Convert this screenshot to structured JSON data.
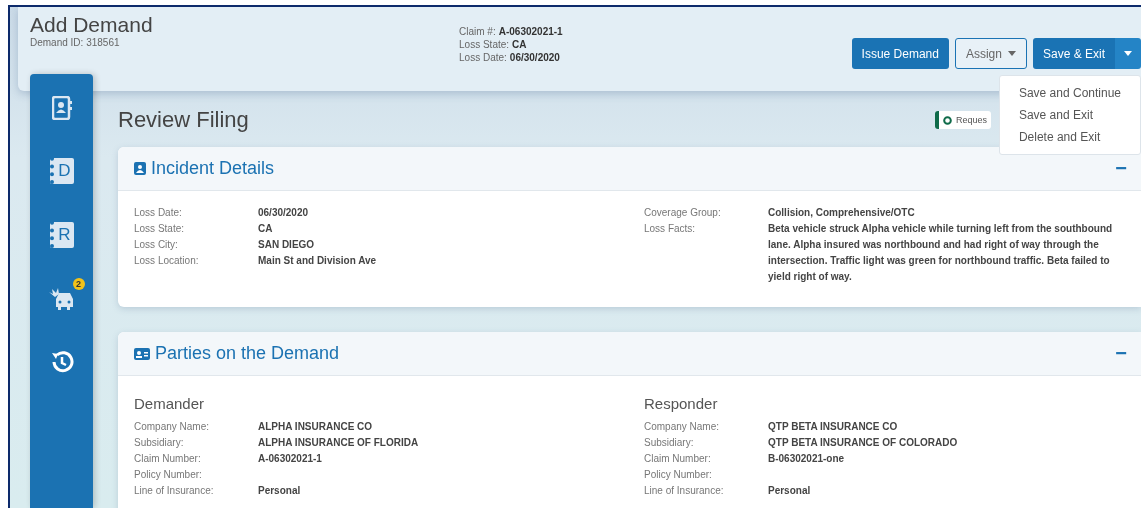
{
  "header": {
    "title": "Add Demand",
    "subtitle": "Demand ID: 318561",
    "meta": [
      {
        "label": "Claim #:",
        "value": "A-06302021-1"
      },
      {
        "label": "Loss State:",
        "value": "CA"
      },
      {
        "label": "Loss Date:",
        "value": "06/30/2020"
      }
    ],
    "buttons": [
      {
        "kind": "primary",
        "label": "Issue Demand"
      },
      {
        "kind": "outline",
        "label": "Assign"
      },
      {
        "kind": "split",
        "label": "Save & Exit",
        "expanded": true
      }
    ],
    "menu": [
      "Save and Continue",
      "Save and Exit",
      "Delete and Exit"
    ]
  },
  "sidebar": [
    {
      "kind": "contacts"
    },
    {
      "kind": "book",
      "letter": "D"
    },
    {
      "kind": "book",
      "letter": "R"
    },
    {
      "kind": "crash",
      "badge": "2"
    },
    {
      "kind": "history"
    }
  ],
  "page_title": "Review Filing",
  "status": "Reques",
  "sections": [
    {
      "title": "Incident Details",
      "kind": "contact",
      "toggle": "−",
      "columns": [
        {
          "rows": [
            {
              "label": "Loss Date:",
              "value": "06/30/2020"
            },
            {
              "label": "Loss State:",
              "value": "CA"
            },
            {
              "label": "Loss City:",
              "value": "SAN DIEGO"
            },
            {
              "label": "Loss Location:",
              "value": "Main St and Division Ave"
            }
          ]
        },
        {
          "rows": [
            {
              "label": "Coverage Group:",
              "value": "Collision, Comprehensive/OTC"
            },
            {
              "label": "Loss Facts:",
              "value": "Beta vehicle struck Alpha vehicle while turning left from the southbound lane. Alpha insured was northbound and had right of way through the intersection. Traffic light was green for northbound traffic. Beta failed to yield right of way."
            }
          ]
        }
      ]
    },
    {
      "title": "Parties on the Demand",
      "kind": "card",
      "toggle": "−",
      "columns": [
        {
          "heading": "Demander",
          "rows": [
            {
              "label": "Company Name:",
              "value": "ALPHA INSURANCE CO"
            },
            {
              "label": "Subsidiary:",
              "value": "ALPHA INSURANCE OF FLORIDA"
            },
            {
              "label": "Claim Number:",
              "value": "A-06302021-1"
            },
            {
              "label": "Policy Number:"
            },
            {
              "label": "Line of Insurance:",
              "value": "Personal"
            }
          ]
        },
        {
          "heading": "Responder",
          "rows": [
            {
              "label": "Company Name:",
              "value": "QTP BETA INSURANCE CO"
            },
            {
              "label": "Subsidiary:",
              "value": "QTP BETA INSURANCE OF COLORADO"
            },
            {
              "label": "Claim Number:",
              "value": "B-06302021-one"
            },
            {
              "label": "Policy Number:"
            },
            {
              "label": "Line of Insurance:",
              "value": "Personal"
            }
          ]
        }
      ]
    }
  ]
}
